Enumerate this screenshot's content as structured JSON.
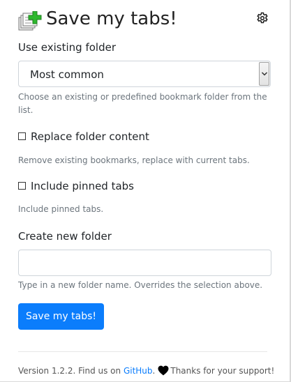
{
  "header": {
    "title": "Save my tabs!",
    "logo_icon": "bookmark-add-icon",
    "settings_icon": "gear-icon"
  },
  "folder_select": {
    "label": "Use existing folder",
    "selected": "Most common",
    "help_line1": "Choose an existing or predefined bookmark folder from the",
    "help_line2": "list."
  },
  "replace_option": {
    "label": "Replace folder content",
    "checked": false,
    "help": "Remove existing bookmarks, replace with current tabs."
  },
  "pinned_option": {
    "label": "Include pinned tabs",
    "checked": false,
    "help": "Include pinned tabs."
  },
  "new_folder": {
    "label": "Create new folder",
    "value": "",
    "placeholder": "",
    "help": "Type in a new folder name. Overrides the selection above."
  },
  "save_button": {
    "label": "Save my tabs!"
  },
  "footer": {
    "version_text": "Version 1.2.2. Find us on ",
    "github_link": "GitHub",
    "period": ".",
    "thanks": "Thanks for your support!"
  },
  "colors": {
    "primary": "#0b7dfc",
    "logo_green": "#2eb82e",
    "muted_text": "#6c757d"
  }
}
